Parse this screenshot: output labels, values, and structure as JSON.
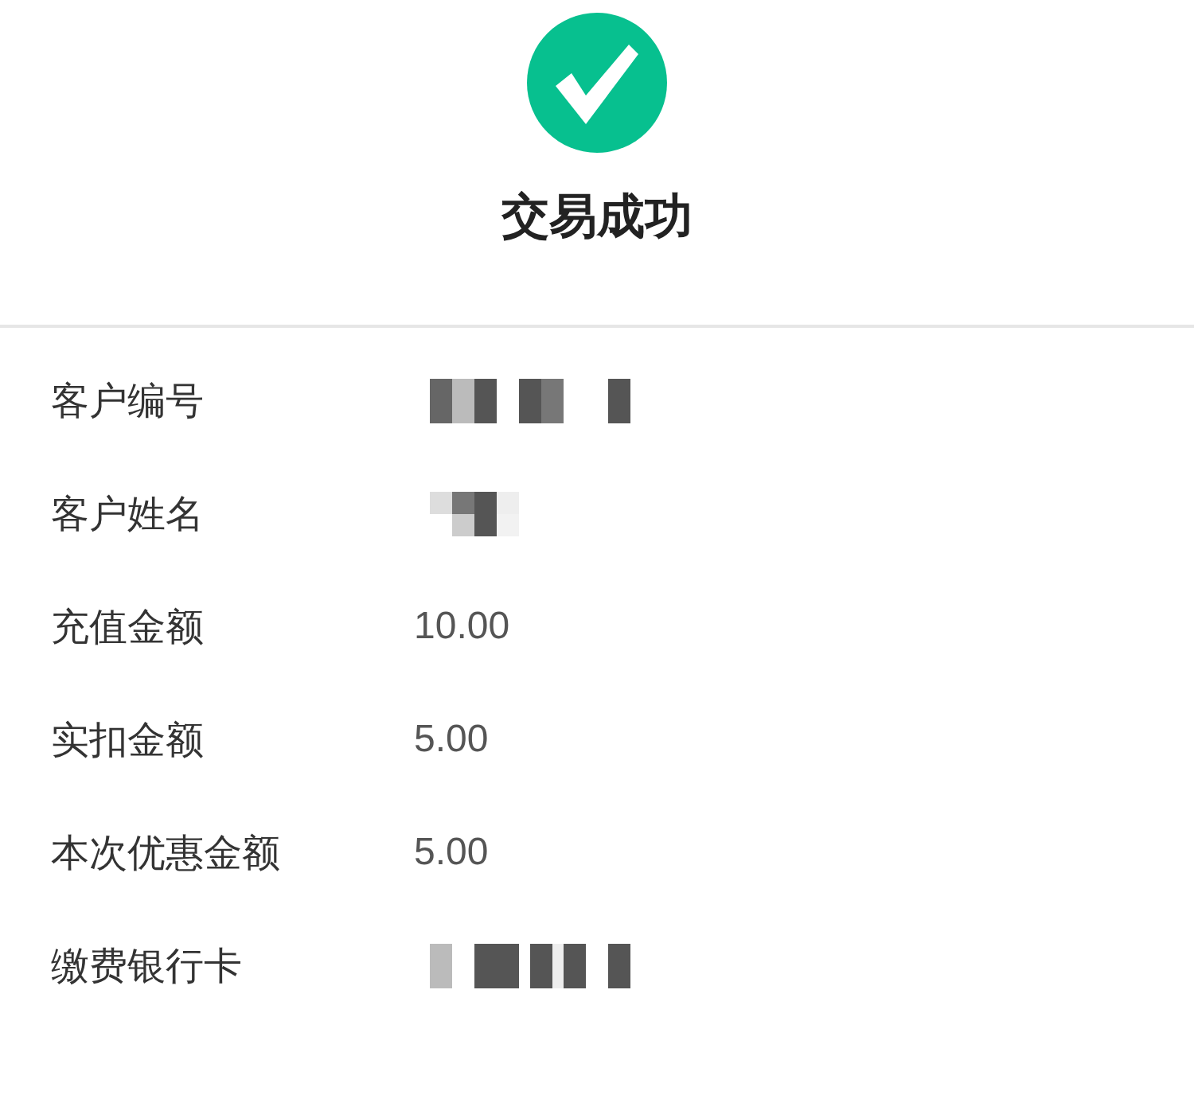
{
  "status": {
    "title": "交易成功",
    "kind": "success"
  },
  "details": [
    {
      "label": "客户编号",
      "kind": "masked"
    },
    {
      "label": "客户姓名",
      "kind": "masked"
    },
    {
      "label": "充值金额",
      "kind": "text",
      "value": "10.00"
    },
    {
      "label": "实扣金额",
      "kind": "text",
      "value": "5.00"
    },
    {
      "label": "本次优惠金额",
      "kind": "text",
      "value": "5.00"
    },
    {
      "label": "缴费银行卡",
      "kind": "masked"
    }
  ]
}
